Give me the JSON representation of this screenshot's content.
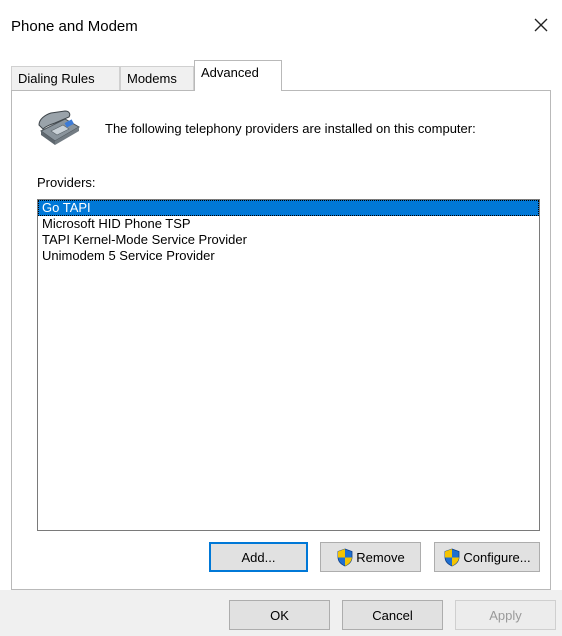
{
  "window": {
    "title": "Phone and Modem"
  },
  "tabs": [
    {
      "label": "Dialing Rules",
      "active": false
    },
    {
      "label": "Modems",
      "active": false
    },
    {
      "label": "Advanced",
      "active": true
    }
  ],
  "advanced": {
    "icon": "telephone-icon",
    "intro_text": "The following telephony providers are installed on this computer:",
    "providers_label": "Providers:",
    "providers": [
      {
        "name": "Go TAPI",
        "selected": true
      },
      {
        "name": "Microsoft HID Phone TSP",
        "selected": false
      },
      {
        "name": "TAPI Kernel-Mode Service Provider",
        "selected": false
      },
      {
        "name": "Unimodem 5 Service Provider",
        "selected": false
      }
    ],
    "buttons": {
      "add": "Add...",
      "remove": "Remove",
      "configure": "Configure..."
    }
  },
  "dialog_buttons": {
    "ok": "OK",
    "cancel": "Cancel",
    "apply": "Apply"
  },
  "colors": {
    "selection": "#0078d7",
    "shield_blue": "#1f6fd1",
    "shield_yellow": "#f5c400"
  }
}
